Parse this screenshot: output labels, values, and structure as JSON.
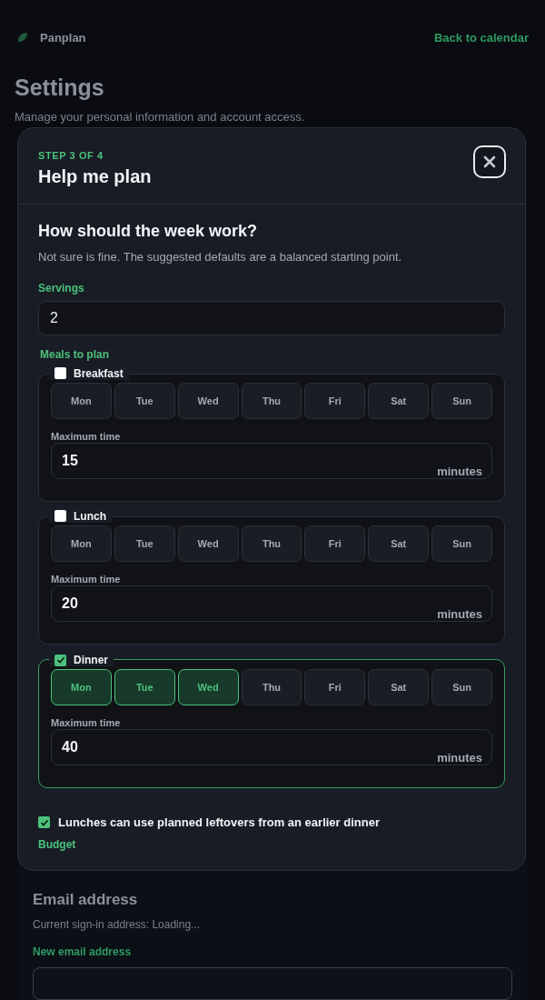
{
  "background": {
    "brand": "Panplan",
    "back_link": "Back to calendar",
    "title": "Settings",
    "subtitle": "Manage your personal information and account access.",
    "section_title": "Email address",
    "section_text": "Current sign-in address: Loading...",
    "field_label": "New email address"
  },
  "modal": {
    "step": "STEP 3 OF 4",
    "title": "Help me plan",
    "heading": "How should the week work?",
    "intro": "Not sure is fine. The suggested defaults are a balanced starting point.",
    "servings": {
      "label": "Servings",
      "value": "2"
    },
    "meals_label": "Meals to plan",
    "meals": [
      {
        "name": "Breakfast",
        "checked": false,
        "days": [
          {
            "label": "Mon",
            "selected": false
          },
          {
            "label": "Tue",
            "selected": false
          },
          {
            "label": "Wed",
            "selected": false
          },
          {
            "label": "Thu",
            "selected": false
          },
          {
            "label": "Fri",
            "selected": false
          },
          {
            "label": "Sat",
            "selected": false
          },
          {
            "label": "Sun",
            "selected": false
          }
        ],
        "time_label": "Maximum time",
        "time_value": "15",
        "unit": "minutes"
      },
      {
        "name": "Lunch",
        "checked": false,
        "days": [
          {
            "label": "Mon",
            "selected": false
          },
          {
            "label": "Tue",
            "selected": false
          },
          {
            "label": "Wed",
            "selected": false
          },
          {
            "label": "Thu",
            "selected": false
          },
          {
            "label": "Fri",
            "selected": false
          },
          {
            "label": "Sat",
            "selected": false
          },
          {
            "label": "Sun",
            "selected": false
          }
        ],
        "time_label": "Maximum time",
        "time_value": "20",
        "unit": "minutes"
      },
      {
        "name": "Dinner",
        "checked": true,
        "days": [
          {
            "label": "Mon",
            "selected": true
          },
          {
            "label": "Tue",
            "selected": true
          },
          {
            "label": "Wed",
            "selected": true
          },
          {
            "label": "Thu",
            "selected": false
          },
          {
            "label": "Fri",
            "selected": false
          },
          {
            "label": "Sat",
            "selected": false
          },
          {
            "label": "Sun",
            "selected": false
          }
        ],
        "time_label": "Maximum time",
        "time_value": "40",
        "unit": "minutes"
      }
    ],
    "leftovers": {
      "label": "Lunches can use planned leftovers from an earlier dinner",
      "checked": true
    },
    "budget_label": "Budget"
  }
}
